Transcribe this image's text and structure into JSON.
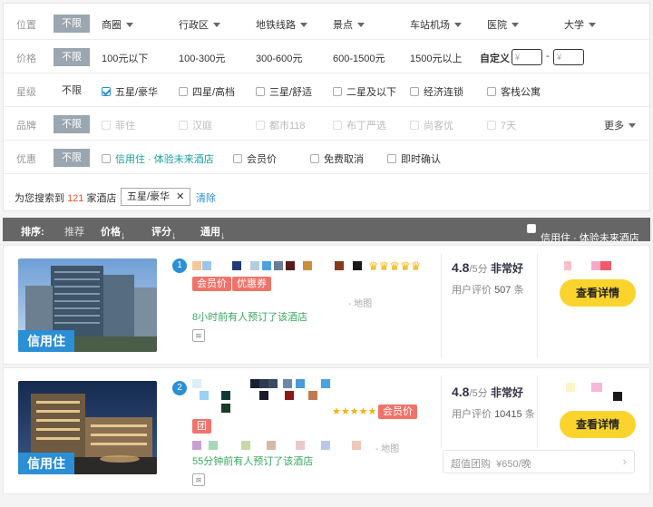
{
  "filter": {
    "location": {
      "label": "位置",
      "unlimited": "不限",
      "options": [
        "商圈",
        "行政区",
        "地铁线路",
        "景点",
        "车站机场",
        "医院",
        "大学"
      ]
    },
    "price": {
      "label": "价格",
      "unlimited": "不限",
      "options": [
        "100元以下",
        "100-300元",
        "300-600元",
        "600-1500元",
        "1500元以上"
      ],
      "custom_label": "自定义",
      "min_placeholder": "¥",
      "max_placeholder": "¥",
      "dash": "-"
    },
    "star": {
      "label": "星级",
      "unlimited": "不限",
      "options": [
        "五星/豪华",
        "四星/高档",
        "三星/舒适",
        "二星及以下",
        "经济连锁",
        "客栈公寓"
      ]
    },
    "brand": {
      "label": "品牌",
      "unlimited": "不限",
      "options": [
        "菲住",
        "汉庭",
        "都市118",
        "布丁严选",
        "尚客优",
        "7天"
      ],
      "more": "更多"
    },
    "promo": {
      "label": "优惠",
      "unlimited": "不限",
      "options": [
        "信用住 · 体验未来酒店",
        "会员价",
        "免费取消",
        "即时确认"
      ]
    }
  },
  "summary": {
    "prefix": "为您搜索到",
    "count": "121",
    "suffix": "家酒店",
    "active_tag": "五星/豪华",
    "remove": "✕",
    "clear": "清除"
  },
  "sortbar": {
    "label": "排序:",
    "items": [
      "推荐",
      "价格",
      "评分",
      "通用"
    ],
    "credit_filter": "信用住 · 体验未来酒店"
  },
  "results": [
    {
      "index": "1",
      "credit_badge": "信用住",
      "tags": [
        "会员价",
        "优惠券"
      ],
      "map": "- 地图",
      "recent": "8小时前有人预订了该酒店",
      "wifi": "≋",
      "rating": "4.8",
      "rating_max": "/5分",
      "rating_word": "非常好",
      "review_prefix": "用户评价",
      "review_count": "507",
      "review_suffix": "条",
      "button": "查看详情",
      "crowns": "♛♛♛♛♛"
    },
    {
      "index": "2",
      "credit_badge": "信用住",
      "tags": [
        "会员价",
        "团"
      ],
      "map": "- 地图",
      "recent": "55分钟前有人预订了该酒店",
      "wifi": "≋",
      "rating": "4.8",
      "rating_max": "/5分",
      "rating_word": "非常好",
      "review_prefix": "用户评价",
      "review_count": "10415",
      "review_suffix": "条",
      "button": "查看详情",
      "stars": "★★★★★",
      "group_deal": "超值团购",
      "group_price": "¥650/晚"
    }
  ],
  "colors": {
    "accent_blue": "#2b8fd6",
    "button_yellow": "#fbd32d",
    "tag_red": "#f0736a",
    "green": "#3aa860",
    "gold": "#f2b30a"
  }
}
